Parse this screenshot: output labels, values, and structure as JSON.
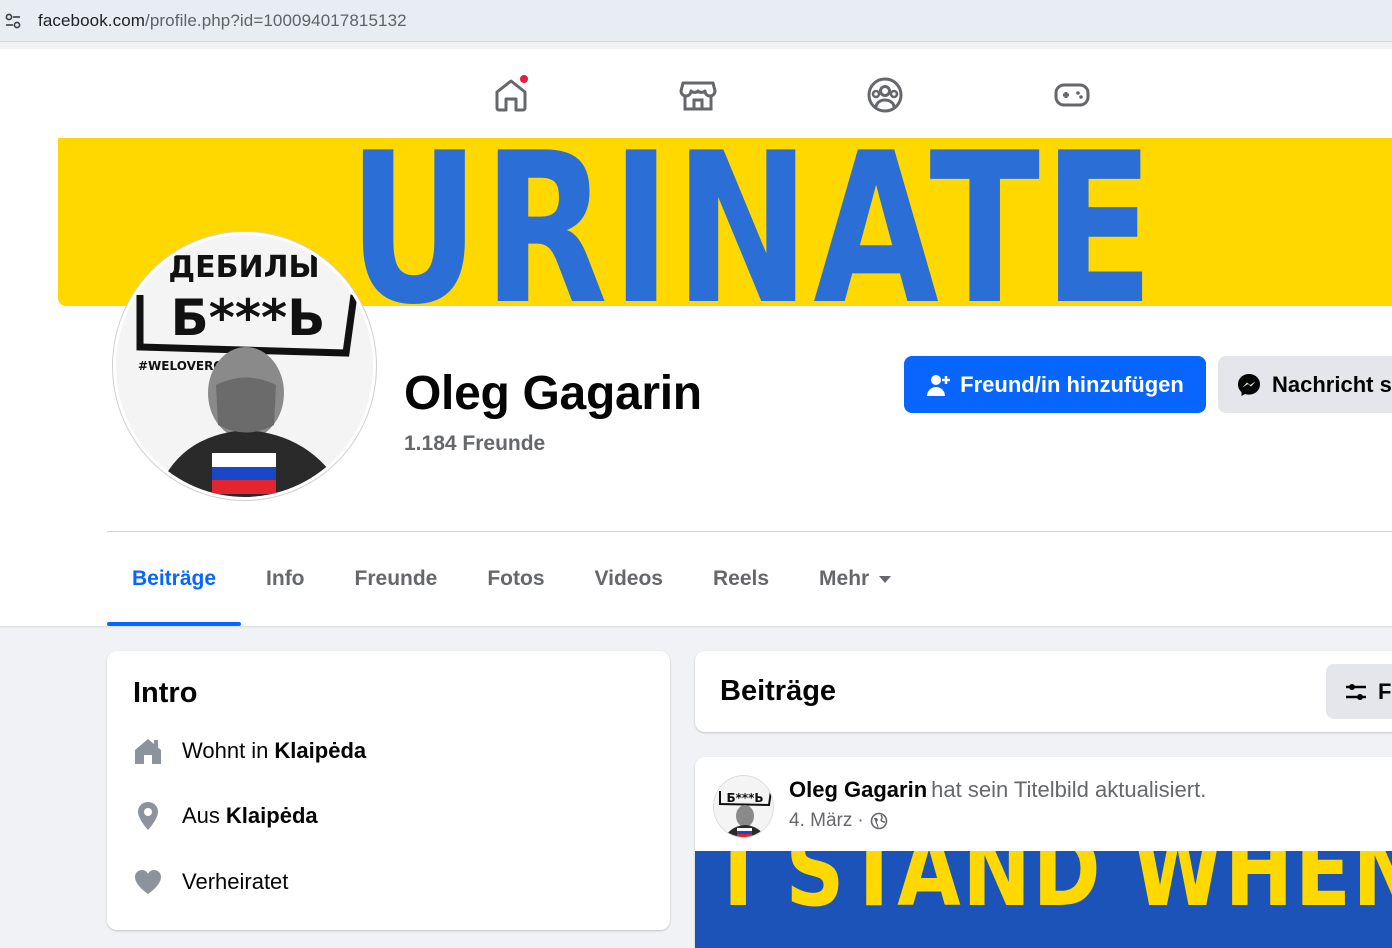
{
  "browser": {
    "url_domain": "facebook.com",
    "url_path": "/profile.php?id=100094017815132",
    "site_icon": "site-settings-icon"
  },
  "topnav": {
    "items": [
      {
        "name": "home",
        "icon": "home-icon",
        "has_notification": true
      },
      {
        "name": "marketplace",
        "icon": "marketplace-icon",
        "has_notification": false
      },
      {
        "name": "groups",
        "icon": "groups-icon",
        "has_notification": false
      },
      {
        "name": "gaming",
        "icon": "gaming-icon",
        "has_notification": false
      }
    ],
    "notification_color": "#e41e3f"
  },
  "cover": {
    "text": "URINATE",
    "background": "#ffd800",
    "text_color": "#2b6fd6"
  },
  "profile": {
    "name": "Oleg Gagarin",
    "friends": "1.184 Freunde",
    "avatar_text_top": "ДЕБИЛЫ",
    "avatar_text_main": "Б***Ь",
    "avatar_hashtag": "#WELOVEROV"
  },
  "actions": {
    "add_friend": "Freund/in hinzufügen",
    "message": "Nachricht s",
    "accent": "#0866ff"
  },
  "tabs": [
    {
      "label": "Beiträge",
      "active": true
    },
    {
      "label": "Info",
      "active": false
    },
    {
      "label": "Freunde",
      "active": false
    },
    {
      "label": "Fotos",
      "active": false
    },
    {
      "label": "Videos",
      "active": false
    },
    {
      "label": "Reels",
      "active": false
    },
    {
      "label": "Mehr",
      "active": false
    }
  ],
  "intro": {
    "title": "Intro",
    "rows": [
      {
        "icon": "home-icon",
        "prefix": "Wohnt in",
        "value": "Klaipėda"
      },
      {
        "icon": "location-pin-icon",
        "prefix": "Aus",
        "value": "Klaipėda"
      },
      {
        "icon": "heart-icon",
        "prefix": "Verheiratet",
        "value": ""
      }
    ]
  },
  "posts": {
    "title": "Beiträge",
    "filter_label": "F",
    "post": {
      "author": "Oleg Gagarin",
      "action": "hat sein Titelbild aktualisiert.",
      "date": "4. März",
      "separator": "·",
      "privacy_icon": "globe-icon",
      "image_text": "I STAND WHEN"
    }
  }
}
